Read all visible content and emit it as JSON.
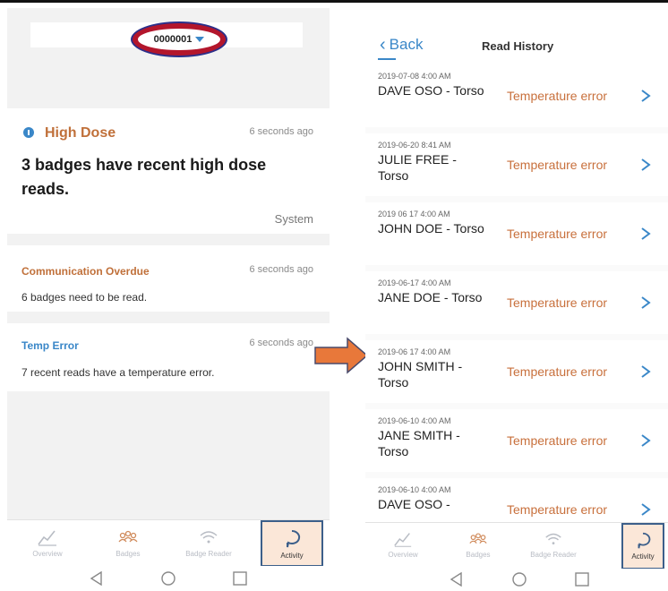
{
  "left": {
    "account": {
      "id": "0000001"
    },
    "alerts": {
      "high_dose": {
        "title": "High Dose",
        "time": "6 seconds ago",
        "message": "3 badges have recent high dose reads.",
        "source": "System"
      },
      "communication": {
        "title": "Communication Overdue",
        "time": "6 seconds ago",
        "message": "6 badges need to be read."
      },
      "temp_error": {
        "title": "Temp Error",
        "time": "6 seconds ago",
        "message": "7 recent reads have a temperature error."
      }
    }
  },
  "tabs": [
    {
      "label": "Overview",
      "icon": "chart-line-icon"
    },
    {
      "label": "Badges",
      "icon": "people-icon"
    },
    {
      "label": "Badge Reader",
      "icon": "wifi-icon"
    },
    {
      "label": "Activity",
      "icon": "activity-bubble-icon"
    }
  ],
  "active_tab": "Activity",
  "right": {
    "back_label": "Back",
    "title": "Read History",
    "rows": [
      {
        "date": "2019-07-08 4:00 AM",
        "name": "DAVE OSO - Torso",
        "status": "Temperature error"
      },
      {
        "date": "2019-06-20 8:41 AM",
        "name": "JULIE FREE - Torso",
        "status": "Temperature error"
      },
      {
        "date": "2019 06 17 4:00 AM",
        "name": "JOHN DOE - Torso",
        "status": "Temperature error"
      },
      {
        "date": "2019-06-17 4:00 AM",
        "name": "JANE DOE - Torso",
        "status": "Temperature error"
      },
      {
        "date": "2019-06 17 4:00 AM",
        "name": "JOHN SMITH - Torso",
        "status": "Temperature error"
      },
      {
        "date": "2019-06-10 4:00 AM",
        "name": "JANE SMITH - Torso",
        "status": "Temperature error"
      },
      {
        "date": "2019-06-10 4:00 AM",
        "name": "DAVE OSO -",
        "status": "Temperature error"
      }
    ]
  },
  "colors": {
    "accent_blue": "#3a87c8",
    "accent_orange": "#c8703c",
    "highlight_oval": "#b3162c",
    "active_tab_bg": "#fbe7d8",
    "arrow": "#e8783a"
  }
}
